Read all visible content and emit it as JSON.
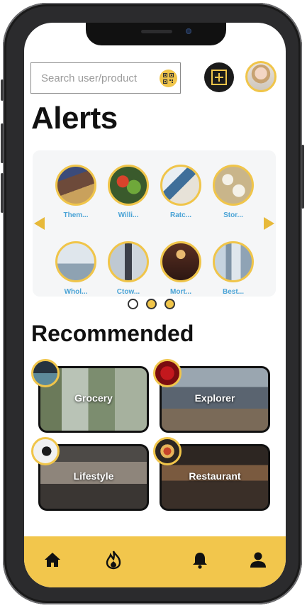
{
  "search": {
    "placeholder": "Search user/product",
    "qr_icon": "qr-code-icon"
  },
  "header": {
    "add_icon": "plus-icon",
    "profile_icon": "avatar"
  },
  "alerts": {
    "title": "Alerts",
    "row1": [
      "Them...",
      "Willi...",
      "Ratc...",
      "Stor..."
    ],
    "row2": [
      "Whol...",
      "Ctow...",
      "Mort...",
      "Best..."
    ],
    "pagination": {
      "pages": 3,
      "active_index": 0
    }
  },
  "recommended": {
    "title": "Recommended",
    "cards": [
      "Grocery",
      "Explorer",
      "Lifestyle",
      "Restaurant"
    ]
  },
  "tabbar": {
    "items": [
      "home-icon",
      "fire-icon",
      "bell-icon",
      "user-icon"
    ]
  },
  "colors": {
    "accent": "#f0c54a",
    "link": "#4aa3d6",
    "dark": "#111111"
  }
}
